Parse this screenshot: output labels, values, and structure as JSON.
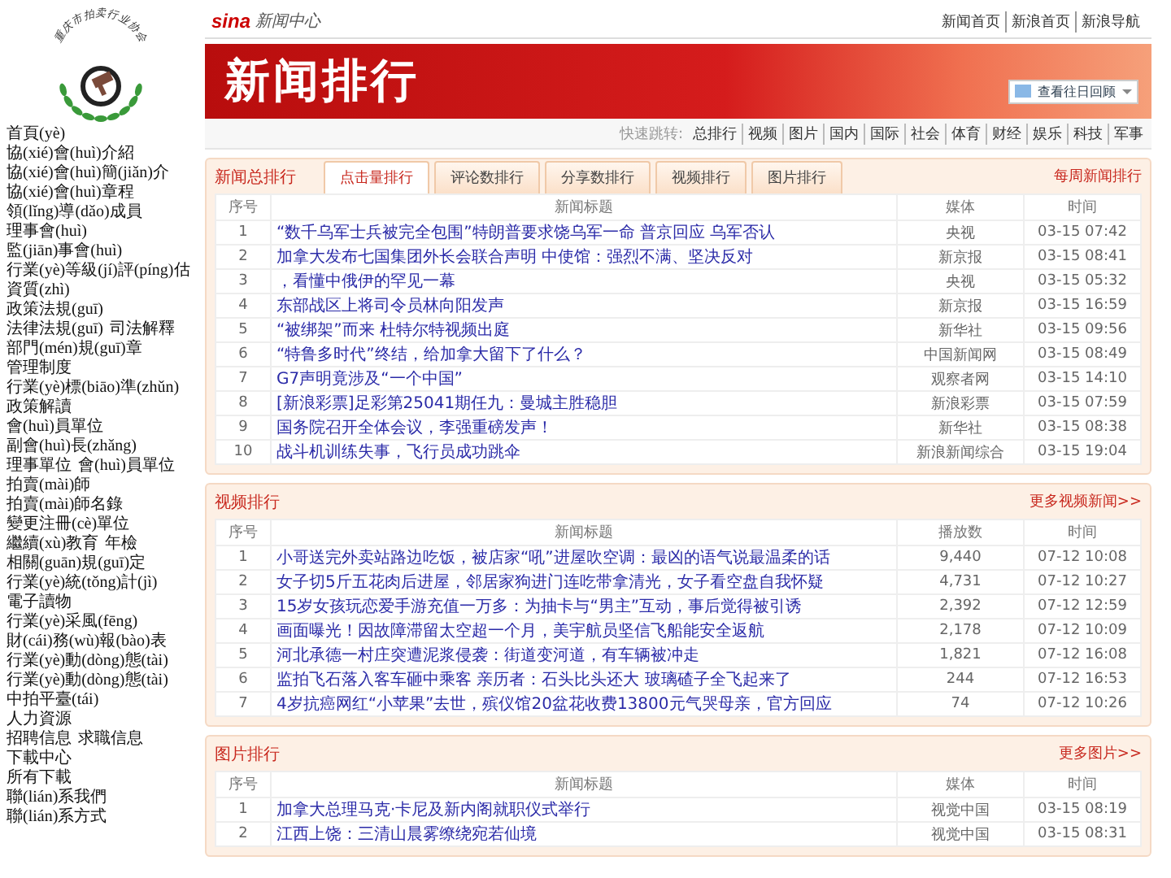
{
  "seal": {
    "text": "重庆市拍卖行业协会"
  },
  "nav_lines": [
    [
      "首頁(yè)"
    ],
    [
      "協(xié)會(huì)介紹"
    ],
    [
      "協(xié)會(huì)簡(jiǎn)介",
      "協(xié)會(huì)章程",
      "領(lǐng)導(dǎo)成員",
      "理事會(huì)",
      "監(jiān)事會(huì)",
      "行業(yè)等級(jí)評(píng)估資質(zhì)"
    ],
    [
      "政策法規(guī)"
    ],
    [
      "法律法規(guī)",
      "司法解釋",
      "部門(mén)規(guī)章",
      "管理制度",
      "行業(yè)標(biāo)準(zhǔn)",
      "政策解讀"
    ],
    [
      "會(huì)員單位"
    ],
    [
      "副會(huì)長(zhǎng)",
      "理事單位",
      "會(huì)員單位"
    ],
    [
      "拍賣(mài)師"
    ],
    [
      "拍賣(mài)師名錄",
      "變更注冊(cè)單位",
      "繼續(xù)教育",
      "年檢",
      "相關(guān)規(guī)定"
    ],
    [
      "行業(yè)統(tǒng)計(jì)"
    ],
    [
      "電子讀物"
    ],
    [
      "行業(yè)采風(fēng)",
      "財(cái)務(wù)報(bào)表"
    ],
    [
      "行業(yè)動(dòng)態(tài)"
    ],
    [
      "行業(yè)動(dòng)態(tài)"
    ],
    [
      "中拍平臺(tái)"
    ],
    [
      "人力資源"
    ],
    [
      "招聘信息",
      "求職信息"
    ],
    [
      "下載中心"
    ],
    [
      "所有下載"
    ],
    [
      "聯(lián)系我們"
    ],
    [
      "聯(lián)系方式"
    ]
  ],
  "header": {
    "brand": "sina",
    "site_name": "新闻中心",
    "top_links": [
      "新闻首页",
      "新浪首页",
      "新浪导航"
    ],
    "banner_title": "新闻排行",
    "date_picker": "查看往日回顾",
    "quick_label": "快速跳转:",
    "quick_links": [
      "总排行",
      "视频",
      "图片",
      "国内",
      "国际",
      "社会",
      "体育",
      "财经",
      "娱乐",
      "科技",
      "军事"
    ]
  },
  "news_ranking": {
    "title": "新闻总排行",
    "more": "每周新闻排行",
    "tabs": [
      {
        "label": "点击量排行",
        "selected": true
      },
      {
        "label": "评论数排行",
        "selected": false
      },
      {
        "label": "分享数排行",
        "selected": false
      },
      {
        "label": "视频排行",
        "selected": false
      },
      {
        "label": "图片排行",
        "selected": false
      }
    ],
    "columns": [
      "序号",
      "新闻标题",
      "媒体",
      "时间"
    ],
    "rows": [
      {
        "rank": "1",
        "title": "“数千乌军士兵被完全包围”特朗普要求饶乌军一命 普京回应 乌军否认",
        "source": "央视",
        "time": "03-15 07:42"
      },
      {
        "rank": "2",
        "title": "加拿大发布七国集团外长会联合声明 中使馆：强烈不满、坚决反对",
        "source": "新京报",
        "time": "03-15 08:41"
      },
      {
        "rank": "3",
        "title": "，看懂中俄伊的罕见一幕",
        "source": "央视",
        "time": "03-15 05:32"
      },
      {
        "rank": "4",
        "title": "东部战区上将司令员林向阳发声",
        "source": "新京报",
        "time": "03-15 16:59"
      },
      {
        "rank": "5",
        "title": "“被绑架”而来 杜特尔特视频出庭",
        "source": "新华社",
        "time": "03-15 09:56"
      },
      {
        "rank": "6",
        "title": "“特鲁多时代”终结，给加拿大留下了什么？",
        "source": "中国新闻网",
        "time": "03-15 08:49"
      },
      {
        "rank": "7",
        "title": "G7声明竟涉及“一个中国”",
        "source": "观察者网",
        "time": "03-15 14:10"
      },
      {
        "rank": "8",
        "title": "[新浪彩票]足彩第25041期任九：曼城主胜稳胆",
        "source": "新浪彩票",
        "time": "03-15 07:59"
      },
      {
        "rank": "9",
        "title": "国务院召开全体会议，李强重磅发声！",
        "source": "新华社",
        "time": "03-15 08:38"
      },
      {
        "rank": "10",
        "title": "战斗机训练失事，飞行员成功跳伞",
        "source": "新浪新闻综合",
        "time": "03-15 19:04"
      }
    ]
  },
  "video_ranking": {
    "title": "视频排行",
    "more": "更多视频新闻>>",
    "columns": [
      "序号",
      "新闻标题",
      "播放数",
      "时间"
    ],
    "rows": [
      {
        "rank": "1",
        "title": "小哥送完外卖站路边吃饭，被店家“吼”进屋吹空调：最凶的语气说最温柔的话",
        "source": "9,440",
        "time": "07-12 10:08"
      },
      {
        "rank": "2",
        "title": "女子切5斤五花肉后进屋，邻居家狗进门连吃带拿清光，女子看空盘自我怀疑",
        "source": "4,731",
        "time": "07-12 10:27"
      },
      {
        "rank": "3",
        "title": "15岁女孩玩恋爱手游充值一万多：为抽卡与“男主”互动，事后觉得被引诱",
        "source": "2,392",
        "time": "07-12 12:59"
      },
      {
        "rank": "4",
        "title": "画面曝光！因故障滞留太空超一个月，美宇航员坚信飞船能安全返航",
        "source": "2,178",
        "time": "07-12 10:09"
      },
      {
        "rank": "5",
        "title": "河北承德一村庄突遭泥浆侵袭：街道变河道，有车辆被冲走",
        "source": "1,821",
        "time": "07-12 16:08"
      },
      {
        "rank": "6",
        "title": "监拍飞石落入客车砸中乘客 亲历者：石头比头还大 玻璃碴子全飞起来了",
        "source": "244",
        "time": "07-12 16:53"
      },
      {
        "rank": "7",
        "title": "4岁抗癌网红“小苹果”去世，殡仪馆20盆花收费13800元气哭母亲，官方回应",
        "source": "74",
        "time": "07-12 10:26"
      }
    ]
  },
  "picture_ranking": {
    "title": "图片排行",
    "more": "更多图片>>",
    "columns": [
      "序号",
      "新闻标题",
      "媒体",
      "时间"
    ],
    "rows": [
      {
        "rank": "1",
        "title": "加拿大总理马克·卡尼及新内阁就职仪式举行",
        "source": "视觉中国",
        "time": "03-15 08:19"
      },
      {
        "rank": "2",
        "title": "江西上饶：三清山晨雾缭绕宛若仙境",
        "source": "视觉中国",
        "time": "03-15 08:31"
      }
    ]
  }
}
